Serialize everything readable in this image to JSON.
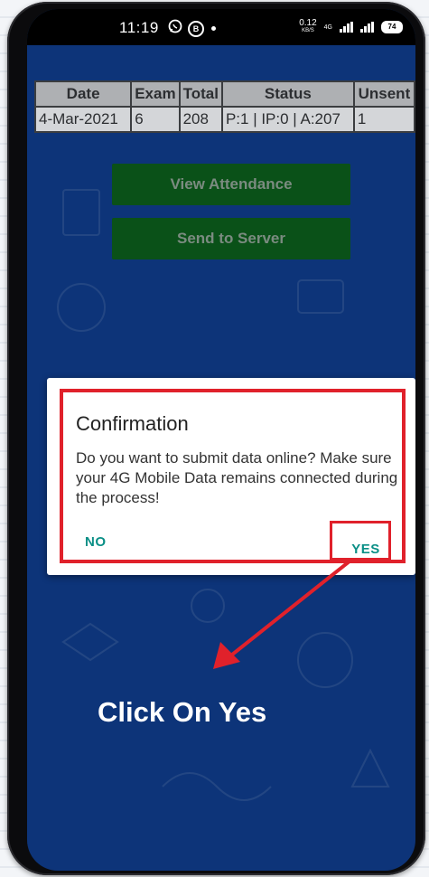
{
  "status_bar": {
    "time": "11:19",
    "whatsapp_icon": "whatsapp-icon",
    "b_icon_label": "B",
    "net_speed": "0.12",
    "net_unit": "KB/S",
    "network_type": "4G",
    "battery": "74"
  },
  "table": {
    "headers": [
      "Date",
      "Exam",
      "Total",
      "Status",
      "Unsent"
    ],
    "row": [
      "4-Mar-2021",
      "6",
      "208",
      "P:1 | IP:0 | A:207",
      "1"
    ]
  },
  "buttons": {
    "view_attendance": "View Attendance",
    "send_to_server": "Send to Server"
  },
  "dialog": {
    "title": "Confirmation",
    "message": "Do you want to submit data online? Make sure your 4G Mobile Data remains connected during the process!",
    "no_label": "NO",
    "yes_label": "YES"
  },
  "annotation": {
    "callout": "Click On Yes"
  },
  "colors": {
    "screen_bg": "#0f3a84",
    "button_green": "#0c5a16",
    "highlight_red": "#e0212b",
    "dialog_button_teal": "#0a8f86"
  }
}
